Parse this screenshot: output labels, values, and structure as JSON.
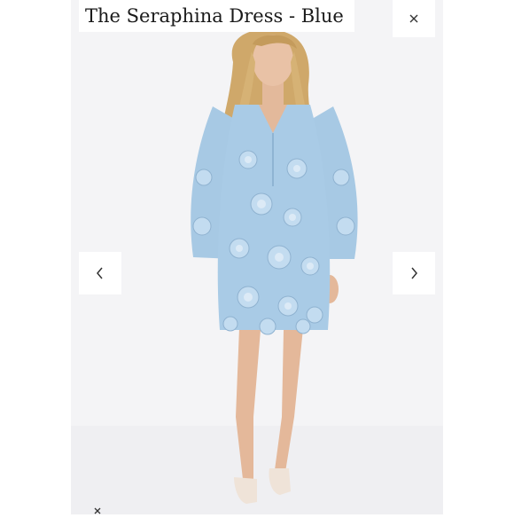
{
  "title": "The Seraphina Dress - Blue",
  "icons": {
    "close": "close-icon",
    "previous": "chevron-left-icon",
    "next": "chevron-right-icon"
  },
  "colors": {
    "background": "#f4f4f6",
    "dress": "#a9cbe6",
    "hair": "#cfa86a",
    "skin": "#e7bfa3",
    "button": "#ffffff"
  }
}
